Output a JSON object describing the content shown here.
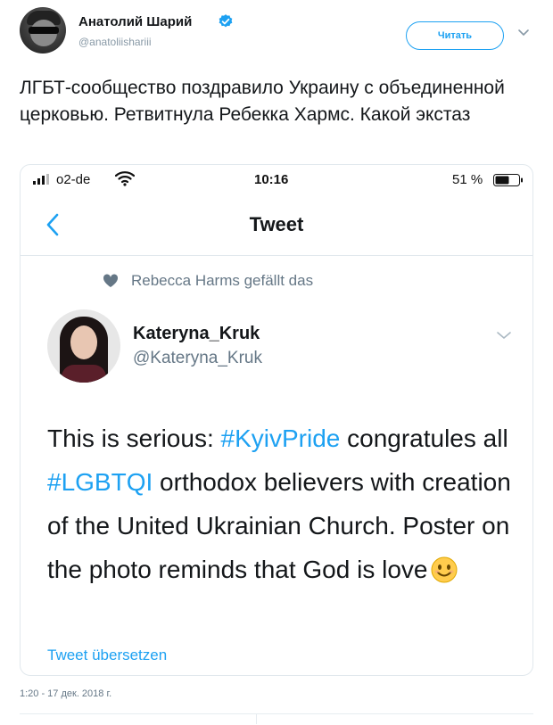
{
  "author": {
    "name": "Анатолий Шарий",
    "handle": "@anatoliishariii",
    "verified": true,
    "verified_color": "#1da1f2"
  },
  "follow_button": {
    "label": "Читать"
  },
  "tweet_text": "ЛГБТ-сообщество поздравило Украину с объединенной церковью. Ретвитнула Ребекка Хармс. Какой экстаз",
  "screenshot": {
    "status_bar": {
      "carrier": "o2-de",
      "time": "10:16",
      "battery": "51 %"
    },
    "nav": {
      "title": "Tweet"
    },
    "liked_by": "Rebecca Harms gefällt das",
    "inner_tweet": {
      "name": "Kateryna_Kruk",
      "handle": "@Kateryna_Kruk",
      "text_parts": {
        "p1": "This is serious: ",
        "tag1": "#KyivPride",
        "p2": " congratules all ",
        "tag2": "#LGBTQI",
        "p3": " orthodox believers with creation of the United Ukrainian Church. Poster on the photo reminds that God is love"
      },
      "emoji": "smiling-face-icon",
      "translate_label": "Tweet übersetzen"
    }
  },
  "timestamp": "1:20 - 17 дек. 2018 г.",
  "colors": {
    "accent": "#1da1f2",
    "text": "#14171a",
    "muted": "#657786"
  }
}
